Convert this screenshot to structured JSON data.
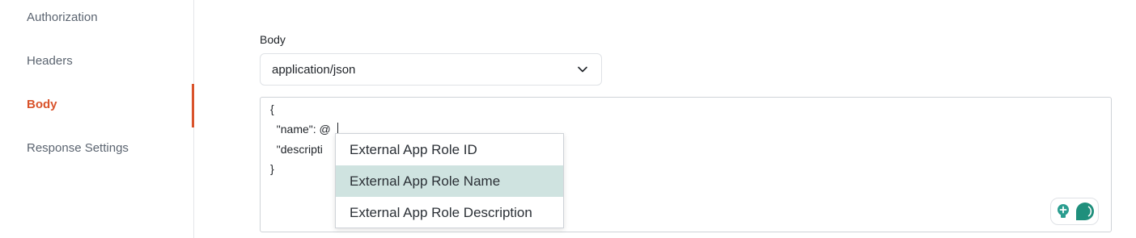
{
  "sidebar": {
    "items": [
      {
        "label": "Authorization",
        "active": false
      },
      {
        "label": "Headers",
        "active": false
      },
      {
        "label": "Body",
        "active": true
      },
      {
        "label": "Response Settings",
        "active": false
      }
    ],
    "active_color": "#d9532b"
  },
  "body": {
    "label": "Body",
    "content_type": "application/json",
    "editor": {
      "lines": [
        "{",
        "  \"name\": @",
        "  \"descripti",
        "}"
      ]
    },
    "autocomplete": {
      "items": [
        {
          "label": "External App Role ID",
          "selected": false
        },
        {
          "label": "External App Role Name",
          "selected": true
        },
        {
          "label": "External App Role Description",
          "selected": false
        }
      ],
      "highlight_color": "#cfe3e0"
    },
    "assistant_icons": [
      "lightbulb-plus-icon",
      "chat-bubble-icon"
    ]
  }
}
